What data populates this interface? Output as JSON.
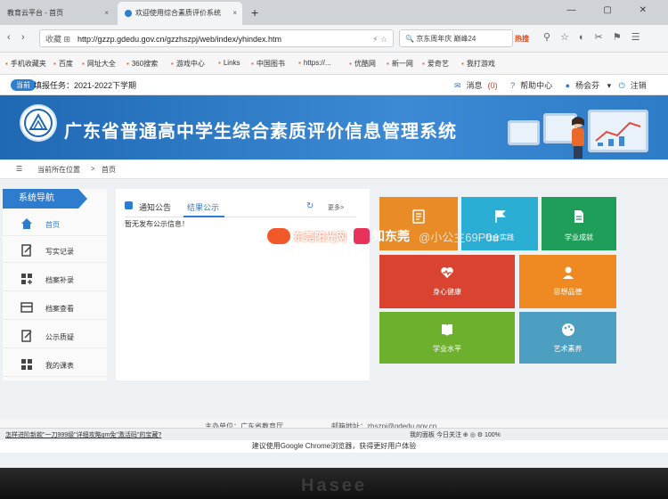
{
  "browser": {
    "tabs": [
      {
        "title": "教育云平台 - 首页"
      },
      {
        "title": "欢迎使用综合素质评价系统"
      }
    ],
    "new_tab_label": "+",
    "nav": {
      "back": "‹",
      "forward": "›"
    },
    "address": {
      "prefix": "收藏 ⊞",
      "url": "http://gzzp.gdedu.gov.cn/gzzhszpj/web/index/yhindex.htm",
      "zoom": "⚡ ☆"
    },
    "search": {
      "text": "京东周年庆 巅峰24"
    },
    "hot_label": "热搜",
    "bookmarks": [
      {
        "label": "手机收藏夹"
      },
      {
        "label": "百度"
      },
      {
        "label": "网址大全"
      },
      {
        "label": "360搜索"
      },
      {
        "label": "游戏中心"
      },
      {
        "label": "Links"
      },
      {
        "label": "中国图书"
      },
      {
        "label": "https://..."
      },
      {
        "label": "优酷网"
      },
      {
        "label": "新一网"
      },
      {
        "label": "爱奇艺"
      },
      {
        "label": "我打游戏"
      }
    ]
  },
  "topbar": {
    "pill": "当前",
    "term": "填报任务：2021-2022下学期",
    "message_label": "消息",
    "message_count": "(0)",
    "help": "帮助中心",
    "user": "杨会芬",
    "logout": "注销"
  },
  "banner": {
    "title": "广东省普通高中学生综合素质评价信息管理系统"
  },
  "breadcrumb": {
    "label": "当前所在位置",
    "sep": ">",
    "current": "首页"
  },
  "sidebar": {
    "title": "系统导航",
    "items": [
      {
        "label": "首页"
      },
      {
        "label": "写实记录"
      },
      {
        "label": "档案补录"
      },
      {
        "label": "档案查看"
      },
      {
        "label": "公示质疑"
      },
      {
        "label": "我的课表"
      }
    ]
  },
  "panel": {
    "tabs": [
      {
        "label": "通知公告"
      },
      {
        "label": "结果公示"
      }
    ],
    "refresh": "↻",
    "more": "更多>",
    "empty_message": "暂无发布公示信息！"
  },
  "tiles": [
    {
      "label": "",
      "icon": "document-icon",
      "color": "#e98c28"
    },
    {
      "label": "社会实践",
      "icon": "flag-icon",
      "color": "#2aaed4"
    },
    {
      "label": "学业成就",
      "icon": "file-icon",
      "color": "#1f9e5a"
    },
    {
      "label": "身心健康",
      "icon": "heart-icon",
      "color": "#d9432f"
    },
    {
      "label": "思想品德",
      "icon": "person-icon",
      "color": "#ef8a22"
    },
    {
      "label": "学业水平",
      "icon": "book-icon",
      "color": "#6db02e"
    },
    {
      "label": "艺术素养",
      "icon": "palette-icon",
      "color": "#4d9fc2"
    }
  ],
  "footer": {
    "org": "主办单位：广东省教育厅",
    "email": "邮箱地址：zhszpj@gdedu.gov.cn"
  },
  "status": {
    "news": "怎样进阶新款\"一刀999级\"详细攻略gm免\"激活码\"的宝藏?",
    "right": "我的面板  今日关注  ⊕  ◎  ⚙  100%"
  },
  "chrome_tip": "建议使用Google Chrome浏览器，获得更好用户体验",
  "watermark": {
    "site": "东莞阳光网",
    "zhi": "知东莞",
    "handle": "@小公主69P0u"
  },
  "laptop_brand": "Hasee"
}
